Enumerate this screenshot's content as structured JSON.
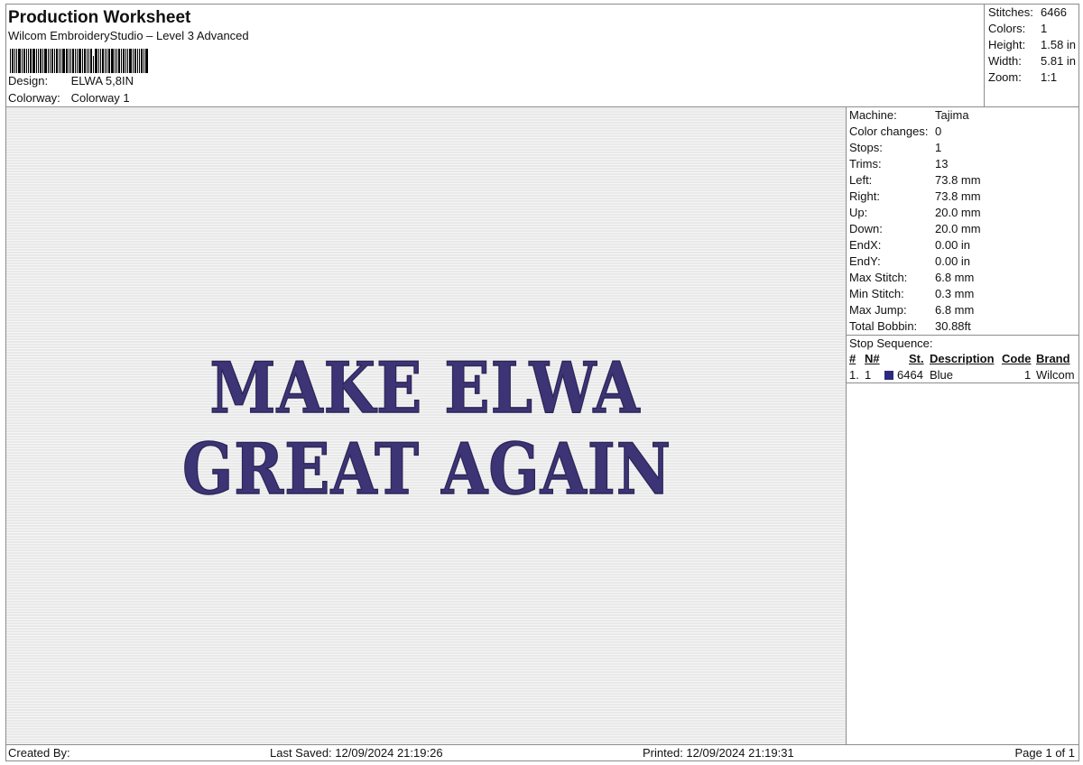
{
  "header": {
    "title": "Production Worksheet",
    "subtitle": "Wilcom EmbroideryStudio – Level 3 Advanced",
    "design_label": "Design:",
    "design_value": "ELWA 5,8IN",
    "colorway_label": "Colorway:",
    "colorway_value": "Colorway 1"
  },
  "stats": [
    {
      "label": "Stitches:",
      "value": "6466"
    },
    {
      "label": "Colors:",
      "value": "1"
    },
    {
      "label": "Height:",
      "value": "1.58 in"
    },
    {
      "label": "Width:",
      "value": "5.81 in"
    },
    {
      "label": "Zoom:",
      "value": "1:1"
    }
  ],
  "design_text": {
    "line1": "MAKE ELWA",
    "line2": "GREAT AGAIN",
    "thread_color": "#3c3475"
  },
  "info": [
    {
      "label": "Machine:",
      "value": "Tajima"
    },
    {
      "label": "Color changes:",
      "value": "0"
    },
    {
      "label": "Stops:",
      "value": "1"
    },
    {
      "label": "Trims:",
      "value": "13"
    },
    {
      "label": "Left:",
      "value": "73.8 mm"
    },
    {
      "label": "Right:",
      "value": "73.8 mm"
    },
    {
      "label": "Up:",
      "value": "20.0 mm"
    },
    {
      "label": "Down:",
      "value": "20.0 mm"
    },
    {
      "label": "EndX:",
      "value": "0.00 in"
    },
    {
      "label": "EndY:",
      "value": "0.00 in"
    },
    {
      "label": "Max Stitch:",
      "value": "6.8 mm"
    },
    {
      "label": "Min Stitch:",
      "value": "0.3 mm"
    },
    {
      "label": "Max Jump:",
      "value": "6.8 mm"
    },
    {
      "label": "Total Bobbin:",
      "value": "30.88ft"
    }
  ],
  "stop_sequence": {
    "title": "Stop Sequence:",
    "headers": {
      "num": "#",
      "n": "N#",
      "st": "St.",
      "description": "Description",
      "code": "Code",
      "brand": "Brand"
    },
    "rows": [
      {
        "num": "1.",
        "n": "1",
        "st": "6464",
        "description": "Blue",
        "code": "1",
        "brand": "Wilcom",
        "color": "#2b2a80"
      }
    ]
  },
  "footer": {
    "created_by": "Created By:",
    "last_saved": "Last Saved: 12/09/2024 21:19:26",
    "printed": "Printed: 12/09/2024 21:19:31",
    "page": "Page 1 of 1"
  }
}
